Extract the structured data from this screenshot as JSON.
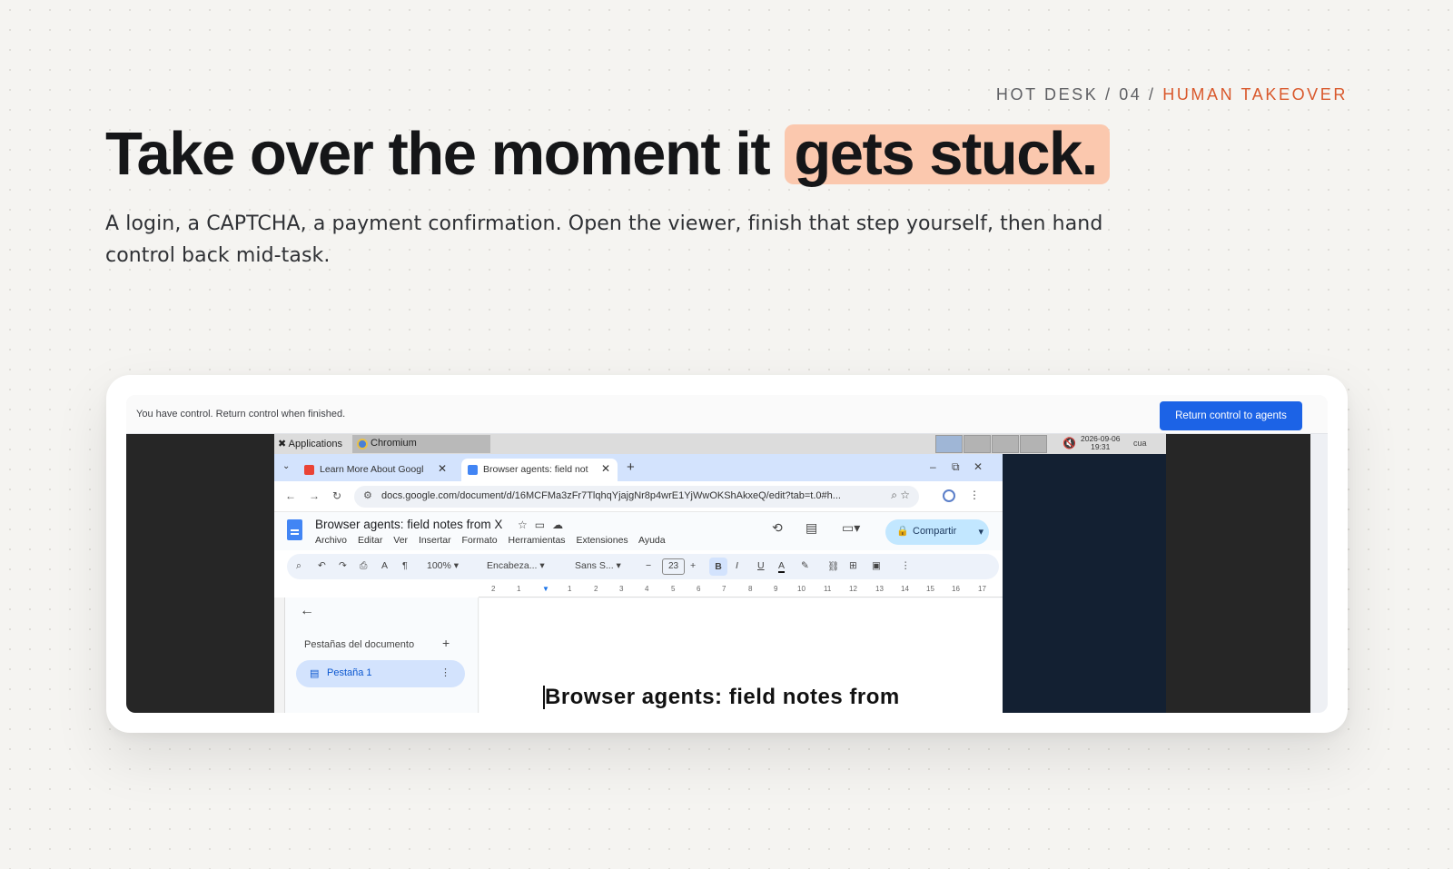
{
  "kicker": {
    "prefix": "HOT DESK / 04 /",
    "accent": "HUMAN TAKEOVER"
  },
  "headline": {
    "main": "Take over the moment it ",
    "highlight": "gets stuck."
  },
  "subtitle": "A login, a CAPTCHA, a payment confirmation. Open the viewer, finish that step yourself, then hand control back mid-task.",
  "viewer": {
    "control_message": "You have control. Return control when finished.",
    "return_button": "Return control to agents"
  },
  "taskbar": {
    "applications": "Applications",
    "chromium": "Chromium",
    "clock_date": "2026-09-06",
    "clock_time": "19:31",
    "user": "cua"
  },
  "browser": {
    "tabs": [
      {
        "label": "Learn More About Googl"
      },
      {
        "label": "Browser agents: field not"
      }
    ],
    "url": "docs.google.com/document/d/16MCFMa3zFr7TlqhqYjajgNr8p4wrE1YjWwOKShAkxeQ/edit?tab=t.0#h..."
  },
  "docs": {
    "title": "Browser agents: field notes from X",
    "menus": [
      "Archivo",
      "Editar",
      "Ver",
      "Insertar",
      "Formato",
      "Herramientas",
      "Extensiones",
      "Ayuda"
    ],
    "share": "Compartir",
    "zoom": "100%",
    "style": "Encabeza...",
    "font": "Sans S...",
    "font_size": "23",
    "ruler_marks": [
      "2",
      "1",
      "1",
      "2",
      "3",
      "4",
      "5",
      "6",
      "7",
      "8",
      "9",
      "10",
      "11",
      "12",
      "13",
      "14",
      "15",
      "16",
      "17"
    ],
    "panel_title": "Pestañas del documento",
    "tab_name": "Pestaña 1",
    "doc_heading": "Browser agents: field notes from"
  },
  "colors": {
    "accent": "#d9582b",
    "highlight": "#fbc8ae",
    "button": "#1c63e6"
  }
}
